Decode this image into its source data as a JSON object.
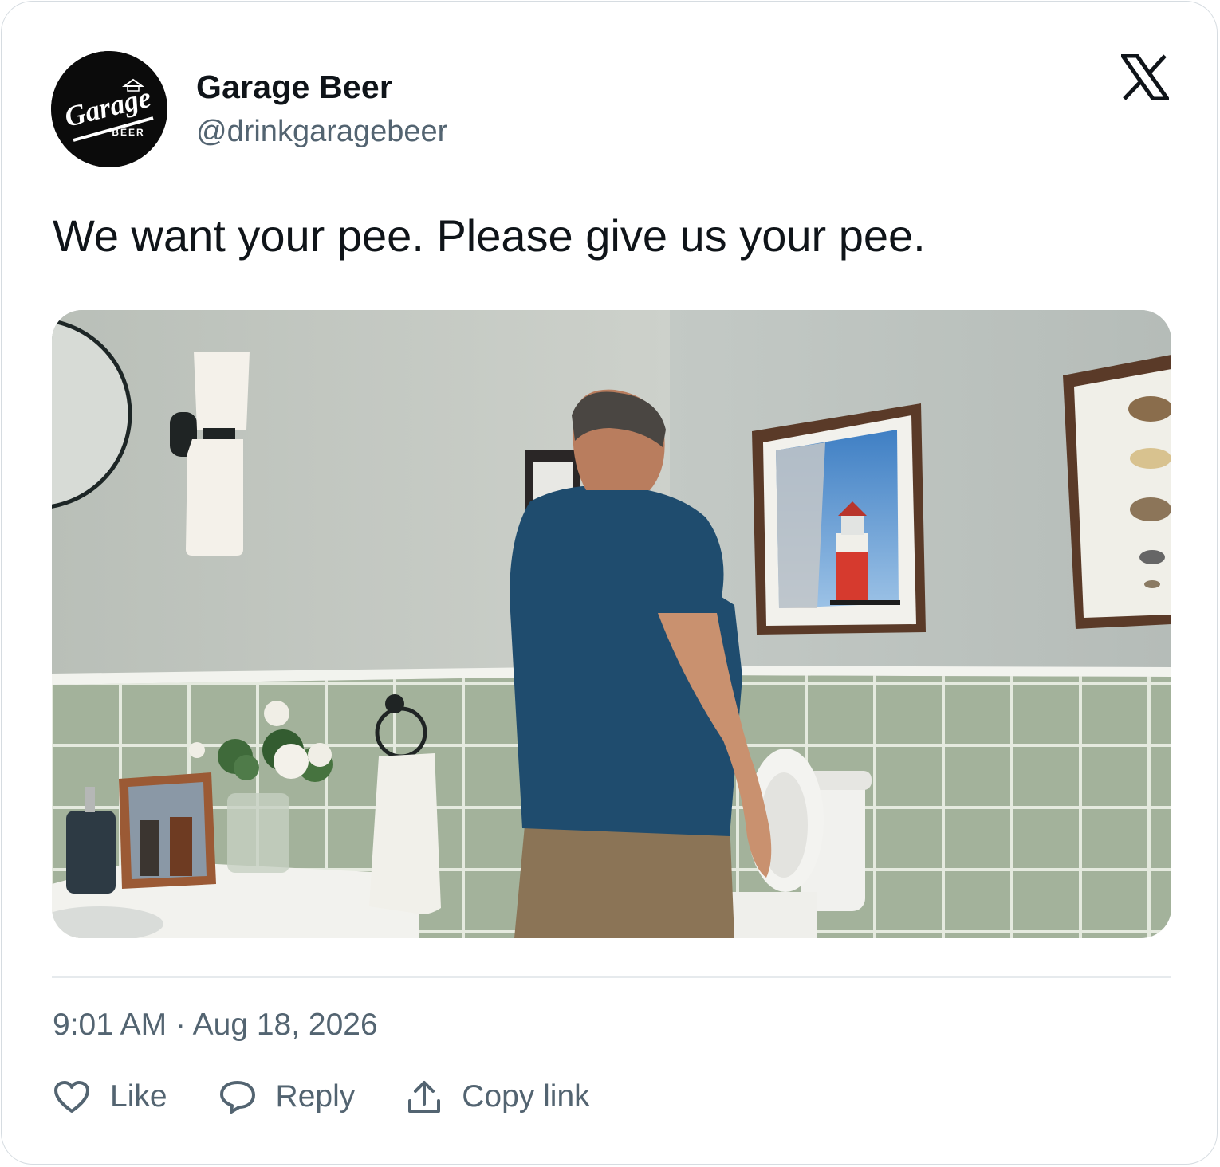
{
  "author": {
    "display_name": "Garage Beer",
    "handle": "@drinkgaragebeer",
    "avatar_logo_text": "Garage",
    "avatar_logo_subtext": "BEER"
  },
  "brand_icon": "x-logo-icon",
  "tweet": {
    "text": "We want your pee. Please give us your pee."
  },
  "media": {
    "type": "video-still",
    "description_icon": "bathroom-scene-image"
  },
  "meta": {
    "time": "9:01 AM",
    "separator": "·",
    "date": "Aug 18, 2026"
  },
  "actions": [
    {
      "icon": "heart-icon",
      "label": "Like"
    },
    {
      "icon": "reply-bubble-icon",
      "label": "Reply"
    },
    {
      "icon": "share-upload-icon",
      "label": "Copy link"
    }
  ],
  "colors": {
    "text_primary": "#0f1419",
    "text_secondary": "#536471",
    "border": "#d6dce1"
  }
}
